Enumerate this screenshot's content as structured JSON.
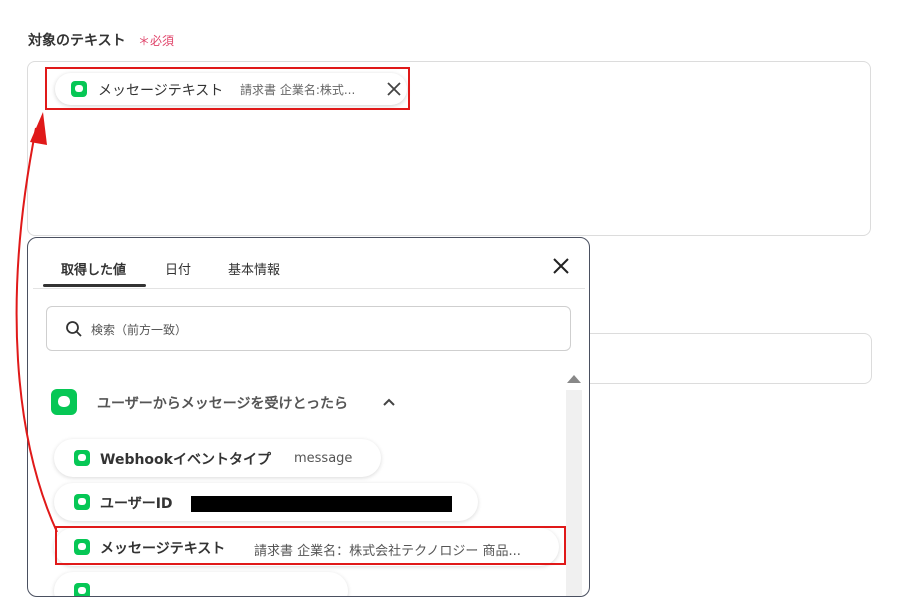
{
  "field": {
    "label": "対象のテキスト",
    "required": "＊必須"
  },
  "selected_chip": {
    "name": "メッセージテキスト",
    "value": "請求書 企業名:株式..."
  },
  "panel": {
    "tabs": [
      {
        "label": "取得した値",
        "active": true
      },
      {
        "label": "日付",
        "active": false
      },
      {
        "label": "基本情報",
        "active": false
      }
    ],
    "search_placeholder": "検索（前方一致）",
    "section_title": "ユーザーからメッセージを受けとったら",
    "items": [
      {
        "name": "Webhookイベントタイプ",
        "value": "message"
      },
      {
        "name": "ユーザーID",
        "value": ""
      },
      {
        "name": "メッセージテキスト",
        "value": "請求書 企業名：株式会社テクノロジー 商品..."
      }
    ]
  },
  "colors": {
    "brand_line": "#06c755",
    "annotation_red": "#e01919",
    "required": "#e0456b"
  },
  "icons": [
    "line-app-icon",
    "close-icon",
    "search-icon",
    "chevron-up-icon"
  ]
}
